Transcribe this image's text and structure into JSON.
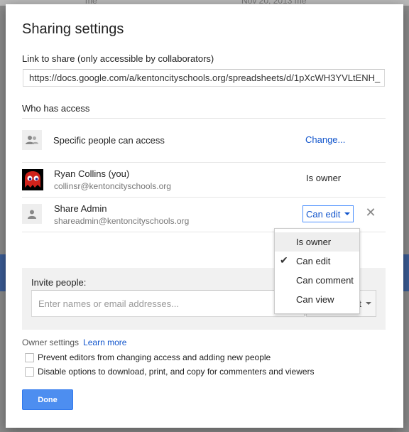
{
  "background": {
    "left_text": "me",
    "right_text": "Nov 20, 2013  me"
  },
  "dialog": {
    "title": "Sharing settings",
    "link_label": "Link to share (only accessible by collaborators)",
    "link_value": "https://docs.google.com/a/kentoncityschools.org/spreadsheets/d/1pXcWH3YVLtENH_",
    "who_has_access_label": "Who has access",
    "access_row": {
      "icon": "group-icon",
      "label": "Specific people can access",
      "change_link": "Change..."
    },
    "people": [
      {
        "name": "Ryan Collins (you)",
        "email": "collinsr@kentoncityschools.org",
        "role": "Is owner",
        "avatar": "red-ghost-avatar"
      },
      {
        "name": "Share Admin",
        "email": "shareadmin@kentoncityschools.org",
        "role": "Can edit",
        "avatar": "person-icon",
        "remove_icon": "close-icon"
      }
    ],
    "role_menu": {
      "items": [
        "Is owner",
        "Can edit",
        "Can comment",
        "Can view"
      ],
      "selected": "Can edit",
      "highlighted": "Is owner"
    },
    "invite": {
      "label": "Invite people:",
      "placeholder": "Enter names or email addresses...",
      "permission": "edit"
    },
    "owner_settings": {
      "label": "Owner settings",
      "learn_more": "Learn more",
      "options": [
        {
          "label": "Prevent editors from changing access and adding new people",
          "checked": false
        },
        {
          "label": "Disable options to download, print, and copy for commenters and viewers",
          "checked": false
        }
      ]
    },
    "done_label": "Done"
  },
  "colors": {
    "link_blue": "#1155cc",
    "done_blue": "#4d8ef0",
    "dropdown_border": "#4d90fe"
  }
}
